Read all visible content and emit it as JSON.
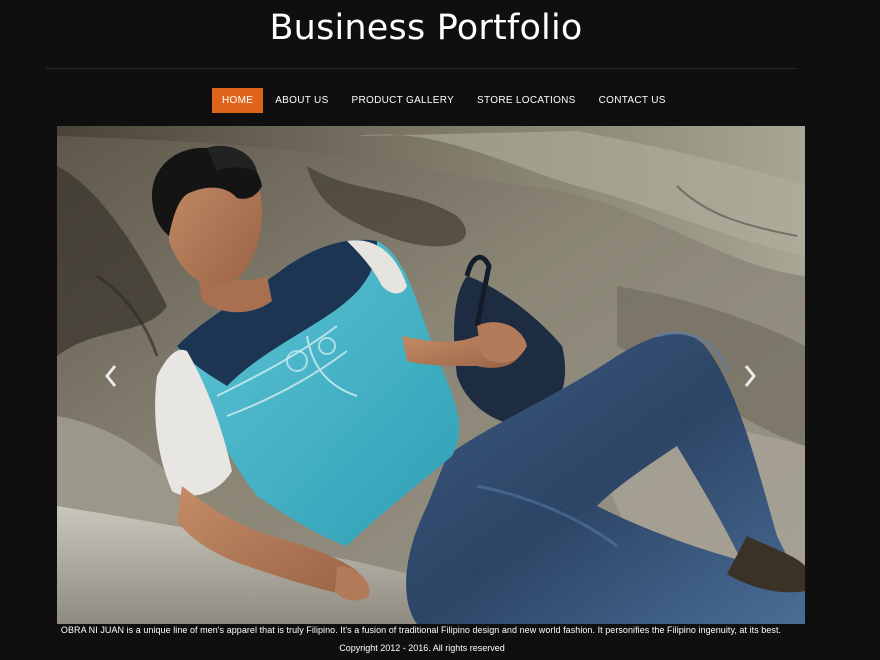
{
  "header": {
    "title": "Business Portfolio"
  },
  "nav": {
    "items": [
      {
        "label": "HOME",
        "active": true
      },
      {
        "label": "ABOUT US",
        "active": false
      },
      {
        "label": "PRODUCT GALLERY",
        "active": false
      },
      {
        "label": "STORE LOCATIONS",
        "active": false
      },
      {
        "label": "CONTACT US",
        "active": false
      }
    ]
  },
  "slider": {
    "prev_icon": "chevron-left-icon",
    "next_icon": "chevron-right-icon"
  },
  "footer": {
    "tagline": "OBRA NI JUAN is a unique line of men's apparel that is truly Filipino. It's a fusion of traditional Filipino design and new world fashion. It personifies the Filipino ingenuity, at its best.",
    "copyright": "Copyright 2012 - 2016. All rights reserved"
  },
  "colors": {
    "background": "#0f0f0f",
    "accent": "#e0641a",
    "text": "#ffffff"
  }
}
